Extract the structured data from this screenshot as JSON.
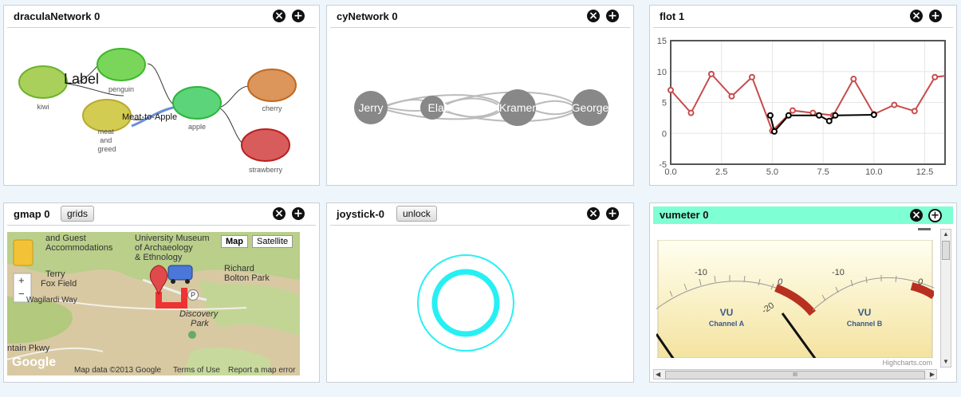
{
  "panels": {
    "dracula": {
      "title": "draculaNetwork 0"
    },
    "cy": {
      "title": "cyNetwork 0"
    },
    "flot": {
      "title": "flot 1"
    },
    "gmap": {
      "title": "gmap 0",
      "button": "grids"
    },
    "joystick": {
      "title": "joystick-0",
      "button": "unlock"
    },
    "vumeter": {
      "title": "vumeter 0"
    }
  },
  "icons": {
    "close": "close-icon",
    "add": "add-icon"
  },
  "dracula_graph": {
    "nodes": [
      {
        "id": "kiwi",
        "label": "kiwi",
        "color": "#a8d05a"
      },
      {
        "id": "penguin",
        "label": "penguin",
        "color": "#7ad65a"
      },
      {
        "id": "meat",
        "label": "meat\nand\ngreed",
        "color": "#d2cc52"
      },
      {
        "id": "apple",
        "label": "apple",
        "color": "#5bd47a"
      },
      {
        "id": "cherry",
        "label": "cherry",
        "color": "#dc955a"
      },
      {
        "id": "strawberry",
        "label": "strawberry",
        "color": "#d95c5c"
      }
    ],
    "edge_labels": [
      "Label",
      "Meat-to-Apple"
    ]
  },
  "cy_graph": {
    "nodes": [
      "Jerry",
      "Elaine",
      "Kramer",
      "George"
    ]
  },
  "chart_data": {
    "type": "line",
    "title": "",
    "xlabel": "",
    "ylabel": "",
    "xlim": [
      0,
      13.5
    ],
    "ylim": [
      -5,
      15
    ],
    "xticks": [
      "0.0",
      "2.5",
      "5.0",
      "7.5",
      "10.0",
      "12.5"
    ],
    "yticks": [
      "15",
      "10",
      "5",
      "0",
      "-5"
    ],
    "series": [
      {
        "color": "#c84b4b",
        "x": [
          0,
          1,
          2,
          3,
          4,
          5,
          6,
          7,
          8,
          9,
          10,
          11,
          12,
          13,
          13.5
        ],
        "y": [
          7,
          3.3,
          9.6,
          6,
          9.1,
          0.4,
          3.7,
          3.3,
          2.9,
          8.8,
          3.1,
          4.6,
          3.6,
          9.1,
          9.3
        ]
      },
      {
        "color": "#000000",
        "x": [
          4.9,
          5.1,
          5.8,
          7.3,
          7.8,
          8.1,
          10.0
        ],
        "y": [
          2.9,
          0.3,
          2.9,
          2.9,
          2.0,
          2.9,
          3.0
        ]
      }
    ]
  },
  "gmap": {
    "labels": [
      "and Guest",
      "Accommodations",
      "University Museum",
      "of Archaeology",
      "& Ethnology",
      "Richard",
      "Bolton Park",
      "Terry",
      "Fox Field",
      "Wagilardi Way",
      "Discovery",
      "Park",
      "ntain Pkwy"
    ],
    "map_button": "Map",
    "satellite_button": "Satellite",
    "zoom_in": "+",
    "zoom_out": "−",
    "google": "Google",
    "attribution": "Map data ©2013 Google",
    "terms": "Terms of Use",
    "report": "Report a map error",
    "poi_icon": "P"
  },
  "vumeter": {
    "left_scale": [
      "-20",
      "-10",
      "0"
    ],
    "right_scale": [
      "-10",
      "0"
    ],
    "left_label": "VU",
    "left_channel": "Channel A",
    "right_label": "VU",
    "right_channel": "Channel B",
    "credit": "Highcharts.com",
    "scroll_grip": "III"
  }
}
